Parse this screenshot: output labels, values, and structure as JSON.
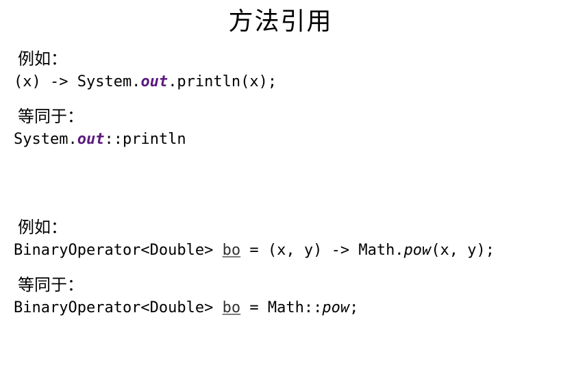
{
  "title": "方法引用",
  "section1": {
    "label1": "例如：",
    "code1_p1": "(x) -> System.",
    "code1_out": "out",
    "code1_p2": ".println(x);",
    "label2": "等同于：",
    "code2_p1": "System.",
    "code2_out": "out",
    "code2_p2": "::println"
  },
  "section2": {
    "label1": "例如：",
    "code3_p1": "BinaryOperator<Double> ",
    "code3_bo": "bo",
    "code3_p2": " = (x, y) -> Math.",
    "code3_pow": "pow",
    "code3_p3": "(x, y);",
    "label2": "等同于：",
    "code4_p1": "BinaryOperator<Double> ",
    "code4_bo": "bo",
    "code4_p2": " = Math::",
    "code4_pow": "pow",
    "code4_p3": ";"
  }
}
